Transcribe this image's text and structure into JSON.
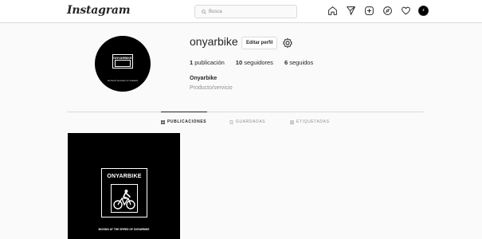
{
  "header": {
    "logo": "Instagram",
    "search_placeholder": "Busca",
    "icons": [
      "home-icon",
      "direct-icon",
      "new-post-icon",
      "explore-icon",
      "activity-icon",
      "profile-avatar"
    ],
    "avatar_initial": "z"
  },
  "profile": {
    "username": "onyarbike",
    "edit_label": "Editar perfil",
    "stats": [
      {
        "count": "1",
        "label": "publicación"
      },
      {
        "count": "10",
        "label": "seguidores"
      },
      {
        "count": "6",
        "label": "seguidos"
      }
    ],
    "full_name": "Onyarbike",
    "category": "Producto/servicio",
    "avatar_brand": "ONYARBIKE",
    "avatar_slogan": "MOVING AT THE SPEED OF ONYARBIKE"
  },
  "tabs": [
    {
      "label": "PUBLICACIONES",
      "active": true
    },
    {
      "label": "GUARDADAS",
      "active": false
    },
    {
      "label": "ETIQUETADAS",
      "active": false
    }
  ],
  "posts": [
    {
      "brand": "ONYARBIKE",
      "slogan": "MOVING AT THE SPEED OF ONYARBIKE"
    }
  ],
  "colors": {
    "background": "#fafafa",
    "border": "#dbdbdb",
    "text": "#262626",
    "muted": "#8e8e8e"
  }
}
